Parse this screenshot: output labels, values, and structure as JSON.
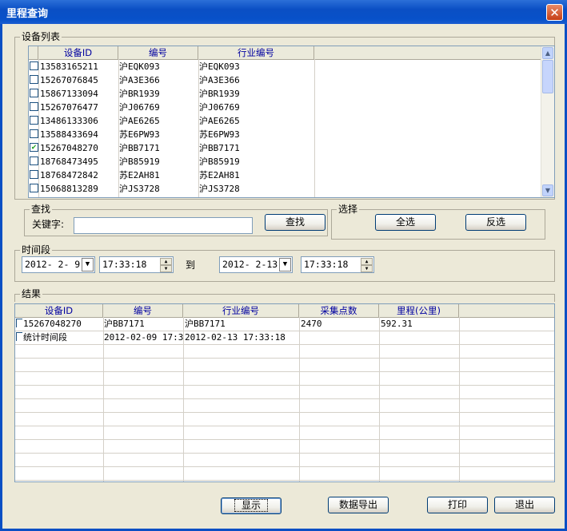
{
  "window": {
    "title": "里程查询",
    "close_glyph": "✕"
  },
  "device_list": {
    "legend": "设备列表",
    "columns": [
      "设备ID",
      "编号",
      "行业编号"
    ],
    "rows": [
      {
        "checked": false,
        "id": "13583165211",
        "code": "沪EQK093",
        "industry_code": "沪EQK093"
      },
      {
        "checked": false,
        "id": "15267076845",
        "code": "沪A3E366",
        "industry_code": "沪A3E366"
      },
      {
        "checked": false,
        "id": "15867133094",
        "code": "沪BR1939",
        "industry_code": "沪BR1939"
      },
      {
        "checked": false,
        "id": "15267076477",
        "code": "沪J06769",
        "industry_code": "沪J06769"
      },
      {
        "checked": false,
        "id": "13486133306",
        "code": "沪AE6265",
        "industry_code": "沪AE6265"
      },
      {
        "checked": false,
        "id": "13588433694",
        "code": "苏E6PW93",
        "industry_code": "苏E6PW93"
      },
      {
        "checked": true,
        "id": "15267048270",
        "code": "沪BB7171",
        "industry_code": "沪BB7171"
      },
      {
        "checked": false,
        "id": "18768473495",
        "code": "沪B85919",
        "industry_code": "沪B85919"
      },
      {
        "checked": false,
        "id": "18768472842",
        "code": "苏E2AH81",
        "industry_code": "苏E2AH81"
      },
      {
        "checked": false,
        "id": "15068813289",
        "code": "沪JS3728",
        "industry_code": "沪JS3728"
      }
    ]
  },
  "search": {
    "legend": "查找",
    "keyword_label": "关键字:",
    "keyword_value": "",
    "search_button": "查找"
  },
  "select": {
    "legend": "选择",
    "select_all": "全选",
    "invert": "反选"
  },
  "time_range": {
    "legend": "时间段",
    "start_date": "2012- 2- 9",
    "start_time": "17:33:18",
    "to_label": "到",
    "end_date": "2012- 2-13",
    "end_time": "17:33:18"
  },
  "results": {
    "legend": "结果",
    "columns": [
      "设备ID",
      "编号",
      "行业编号",
      "采集点数",
      "里程(公里)"
    ],
    "rows": [
      {
        "id": "15267048270",
        "code": "沪BB7171",
        "industry_code": "沪BB7171",
        "points": "2470",
        "mileage": "592.31"
      },
      {
        "id": "统计时间段",
        "code": "2012-02-09 17:33",
        "industry_code": "2012-02-13 17:33:18",
        "points": "",
        "mileage": ""
      }
    ]
  },
  "footer": {
    "show": "显示",
    "export": "数据导出",
    "print": "打印",
    "exit": "退出"
  },
  "icons": {
    "scroll_up": "scroll-up-arrow-icon",
    "scroll_down": "scroll-down-arrow-icon",
    "dropdown": "chevron-down-icon",
    "close": "close-icon"
  }
}
